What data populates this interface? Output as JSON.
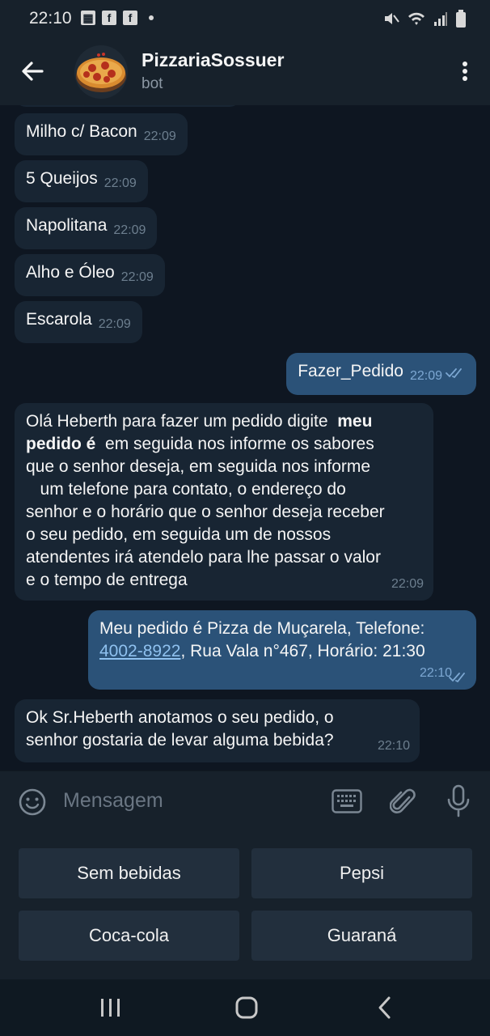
{
  "status_bar": {
    "time": "22:10"
  },
  "header": {
    "title": "PizzariaSossuer",
    "subtitle": "bot"
  },
  "messages": [
    {
      "text": "Milho c/ Bacon",
      "time": "22:09"
    },
    {
      "text": "5 Queijos",
      "time": "22:09"
    },
    {
      "text": "Napolitana",
      "time": "22:09"
    },
    {
      "text": "Alho e Óleo",
      "time": "22:09"
    },
    {
      "text": "Escarola",
      "time": "22:09"
    },
    {
      "text": "Fazer_Pedido",
      "time": "22:09"
    },
    {
      "lines": [
        "Olá Heberth para fazer um pedido digite",
        "meu",
        "pedido é",
        "em seguida nos informe os sabores",
        "que o senhor deseja, em seguida nos informe",
        "um telefone para contato, o endereço do",
        "senhor e o horário que o senhor deseja receber",
        "o seu pedido, em seguida um de nossos",
        "atendentes irá atendelo para lhe passar o valor",
        "e o tempo de entrega"
      ],
      "time": "22:09"
    },
    {
      "line1": "Meu pedido é Pizza de Muçarela, Telefone:",
      "phone": "4002-8922",
      "line2_rest": ", Rua Vala n°467, Horário: 21:30",
      "time": "22:10"
    },
    {
      "line1": "Ok Sr.Heberth anotamos o seu pedido, o",
      "line2": "senhor gostaria de levar alguma bebida?",
      "time": "22:10"
    }
  ],
  "input": {
    "placeholder": "Mensagem"
  },
  "keyboard_buttons": [
    "Sem bebidas",
    "Pepsi",
    "Coca-cola",
    "Guaraná"
  ],
  "colors": {
    "background": "#0e1621",
    "incoming": "#182533",
    "outgoing": "#2b5278",
    "link": "#8fc1ef"
  }
}
